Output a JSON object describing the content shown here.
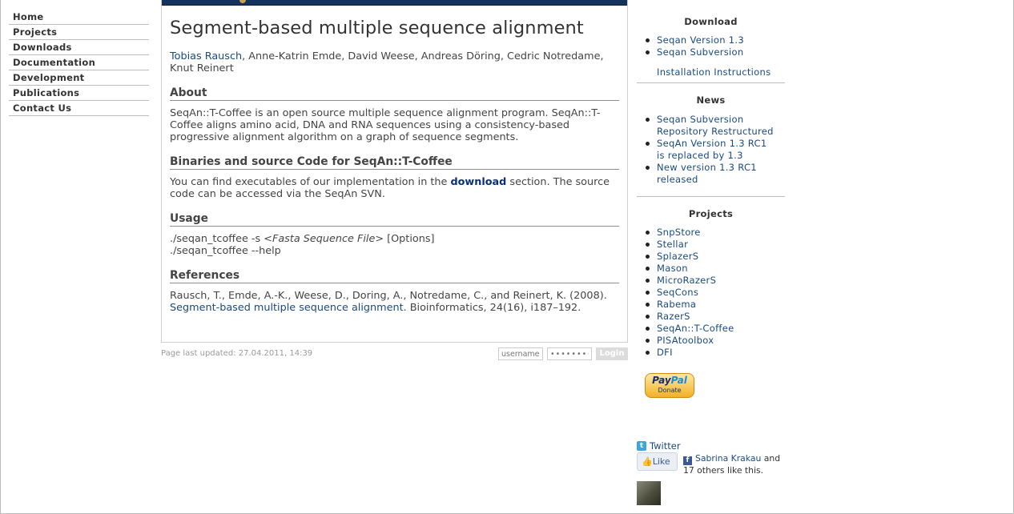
{
  "nav": {
    "items": [
      "Home",
      "Projects",
      "Downloads",
      "Documentation",
      "Development",
      "Publications",
      "Contact Us"
    ]
  },
  "main": {
    "title": "Segment-based multiple sequence alignment",
    "authors_link": "Tobias Rausch",
    "authors_rest": ", Anne-Katrin Emde, David Weese, Andreas Döring, Cedric Notredame, Knut Reinert",
    "about_heading": "About",
    "about_text": "SeqAn::T-Coffee is an open source multiple sequence alignment program. SeqAn::T-Coffee aligns amino acid, DNA and RNA sequences using a consistency-based progressive alignment algorithm on a graph of sequence segments.",
    "binaries_heading": "Binaries and source Code for SeqAn::T-Coffee",
    "binaries_pre": "You can find executables of our implementation in the ",
    "binaries_link": "download",
    "binaries_post": " section. The source code can be accessed via the SeqAn SVN.",
    "usage_heading": "Usage",
    "usage_line1_pre": "./seqan_tcoffee -s ",
    "usage_line1_em": "<Fasta Sequence File>",
    "usage_line1_post": " [Options]",
    "usage_line2": "./seqan_tcoffee --help",
    "references_heading": "References",
    "ref_pre": "Rausch, T., Emde, A.-K., Weese, D., Doring, A., Notredame, C., and Reinert, K. (2008). ",
    "ref_link": "Segment-based multiple sequence alignment",
    "ref_post": ". Bioinformatics, 24(16), i187–192."
  },
  "footer": {
    "updated": "Page last updated: 27.04.2011, 14:39",
    "username_placeholder": "username",
    "password_placeholder": "••••••••",
    "login_label": "Login"
  },
  "sidebar": {
    "download_heading": "Download",
    "download_items": [
      "Seqan Version 1.3",
      "Seqan Subversion"
    ],
    "install_link": "Installation Instructions",
    "news_heading": "News",
    "news_items": [
      "Seqan Subversion Repository Restructured",
      "SeqAn Version 1.3 RC1 is replaced by 1.3",
      "New version 1.3 RC1 released"
    ],
    "projects_heading": "Projects",
    "project_items": [
      "SnpStore",
      "Stellar",
      "SplazerS",
      "Mason",
      "MicroRazerS",
      "SeqCons",
      "Rabema",
      "RazerS",
      "SeqAn::T-Coffee",
      "PISAtoolbox",
      "DFI"
    ],
    "paypal_brand_a": "Pay",
    "paypal_brand_b": "Pal",
    "paypal_donate": "Donate",
    "twitter_label": "Twitter",
    "like_label": "Like",
    "fb_name": "Sabrina Krakau",
    "fb_rest": " and 17 others like this."
  },
  "colors": {
    "link": "#1a4a80",
    "header_bar": "#13335c",
    "bold_link": "#0b2f78"
  }
}
